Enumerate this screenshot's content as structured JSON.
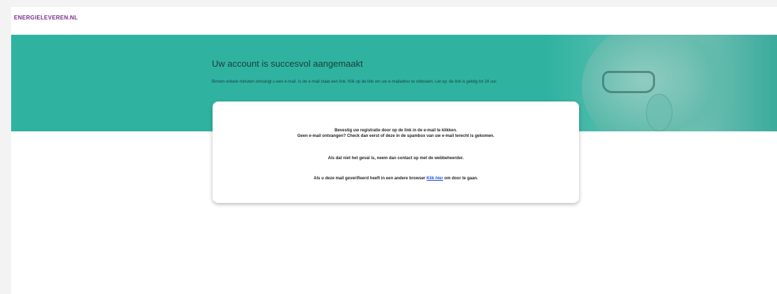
{
  "header": {
    "logo_text": "ENERGIELEVEREN.NL"
  },
  "banner": {
    "title": "Uw account is succesvol aangemaakt",
    "intro": "Binnen enkele minuten ontvangt u een e-mail. Is de e-mail staat een link. Klik op de link om uw e-mailadres te voltooien. Let op: de link is geldig tot 24 uur."
  },
  "card": {
    "line1": "Bevestig uw registratie door op de link in de e-mail te klikken.",
    "line2": "Geen e-mail ontvangen? Check dan eerst of deze in de spambox van uw e-mail terecht is gekomen.",
    "line3": "Als dat niet het geval is, neem dan contact op met de webbeheerder.",
    "line4_prefix": "Als u deze mail geverifieerd heeft in een andere browser",
    "line4_link": "Klik hier",
    "line4_suffix": "om door te gaan."
  },
  "colors": {
    "banner": "#2fb3a0",
    "logo": "#7b2d8e",
    "link": "#1d4fd8"
  }
}
